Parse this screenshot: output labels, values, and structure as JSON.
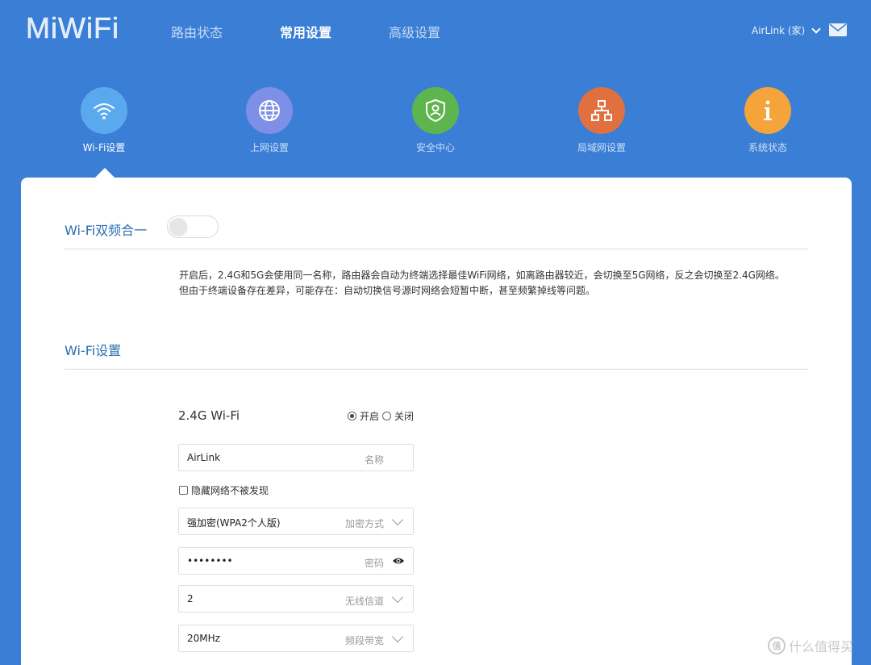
{
  "header": {
    "logo": "MiWiFi",
    "nav": [
      {
        "label": "路由状态",
        "active": false
      },
      {
        "label": "常用设置",
        "active": true
      },
      {
        "label": "高级设置",
        "active": false
      }
    ],
    "account": "AirLink (家)"
  },
  "categories": [
    {
      "label": "Wi-Fi设置",
      "color": "#5aa9ee",
      "icon": "wifi-icon",
      "active": true
    },
    {
      "label": "上网设置",
      "color": "#7d8fe6",
      "icon": "globe-icon",
      "active": false
    },
    {
      "label": "安全中心",
      "color": "#5fb54d",
      "icon": "shield-icon",
      "active": false
    },
    {
      "label": "局域网设置",
      "color": "#e0703f",
      "icon": "network-icon",
      "active": false
    },
    {
      "label": "系统状态",
      "color": "#f4a43b",
      "icon": "info-icon",
      "active": false
    }
  ],
  "dualband": {
    "title": "Wi-Fi双频合一",
    "enabled": false,
    "desc_line1": "开启后，2.4G和5G会使用同一名称，路由器会自动为终端选择最佳WiFi网络，如离路由器较近，会切换至5G网络，反之会切换至2.4G网络。",
    "desc_line2": "但由于终端设备存在差异，可能存在：自动切换信号源时网络会短暂中断，甚至频繁掉线等问题。"
  },
  "wifi_settings": {
    "title": "Wi-Fi设置",
    "band_title": "2.4G Wi-Fi",
    "on_label": "开启",
    "off_label": "关闭",
    "state": "on",
    "name_value": "AirLink",
    "name_hint": "名称",
    "hide_label": "隐藏网络不被发现",
    "encryption_value": "强加密(WPA2个人版)",
    "encryption_hint": "加密方式",
    "password_value": "••••••••",
    "password_hint": "密码",
    "channel_value": "2",
    "channel_hint": "无线信道",
    "bandwidth_value": "20MHz",
    "bandwidth_hint": "频段带宽"
  },
  "watermark": {
    "badge": "值",
    "text": "什么值得买"
  },
  "colors": {
    "brand_blue": "#3a7fd5",
    "title_blue": "#2a6fb0"
  }
}
